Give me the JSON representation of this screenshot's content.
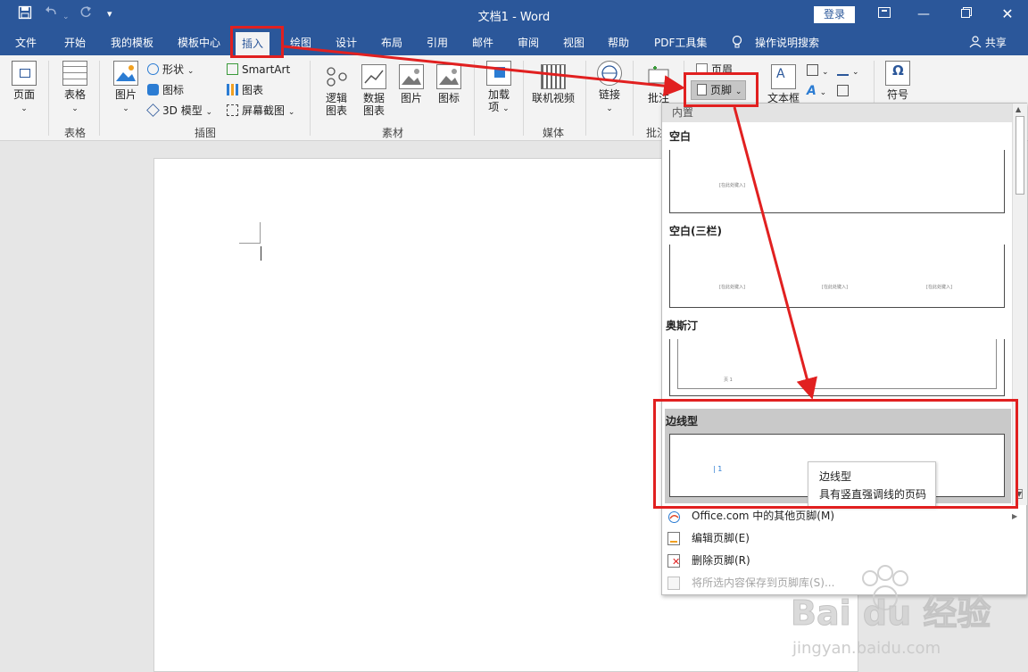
{
  "titlebar": {
    "doc_title": "文档1  -  Word",
    "login_label": "登录",
    "window_controls": [
      "restore-ribbon-icon",
      "minimize-icon",
      "restore-icon",
      "close-icon"
    ]
  },
  "tabs": [
    "文件",
    "开始",
    "我的模板",
    "模板中心",
    "插入",
    "绘图",
    "设计",
    "布局",
    "引用",
    "邮件",
    "审阅",
    "视图",
    "帮助",
    "PDF工具集"
  ],
  "active_tab": "插入",
  "search_label": "操作说明搜索",
  "share_label": "共享",
  "ribbon": {
    "page_btn": "页面",
    "table_btn": "表格",
    "table_group": "表格",
    "picture_btn": "图片",
    "shape_btn": "形状",
    "icon_btn": "图标",
    "model3d_btn": "3D 模型",
    "smartart_btn": "SmartArt",
    "chart_btn": "图表",
    "screenshot_btn": "屏幕截图",
    "illustrations_group": "插图",
    "logic_chart": [
      "逻辑",
      "图表"
    ],
    "data_chart": [
      "数据",
      "图表"
    ],
    "picture2_btn": "图片",
    "icon2_btn": "图标",
    "material_group": "素材",
    "addin_btn": [
      "加载",
      "项"
    ],
    "online_video_btn": "联机视频",
    "media_group": "媒体",
    "link_btn": "链接",
    "comment_btn": "批注",
    "comment_group": "批注",
    "header_btn": "页眉",
    "footer_btn": "页脚",
    "textbox_btn": "文本框",
    "symbol_btn": "符号"
  },
  "gallery": {
    "header": "内置",
    "items": [
      {
        "title": "空白",
        "preview_text": "[在此处键入]"
      },
      {
        "title": "空白(三栏)",
        "preview_text": "[在此处键入]"
      },
      {
        "title": "奥斯汀",
        "preview_text": "页 1"
      },
      {
        "title": "边线型",
        "preview_text": "| 1"
      }
    ]
  },
  "tooltip": {
    "title": "边线型",
    "description": "具有竖直强调线的页码"
  },
  "menu": [
    {
      "label": "Office.com 中的其他页脚(M)",
      "enabled": true
    },
    {
      "label": "编辑页脚(E)",
      "enabled": true
    },
    {
      "label": "删除页脚(R)",
      "enabled": true
    },
    {
      "label": "将所选内容保存到页脚库(S)...",
      "enabled": false
    }
  ],
  "watermark": {
    "brand": "Bai du 经验",
    "url": "jingyan.baidu.com"
  },
  "colors": {
    "accent": "#2b579a",
    "annotation": "#e12020",
    "ribbon_bg": "#f3f3f3",
    "selected_item": "#c9c9c9"
  }
}
